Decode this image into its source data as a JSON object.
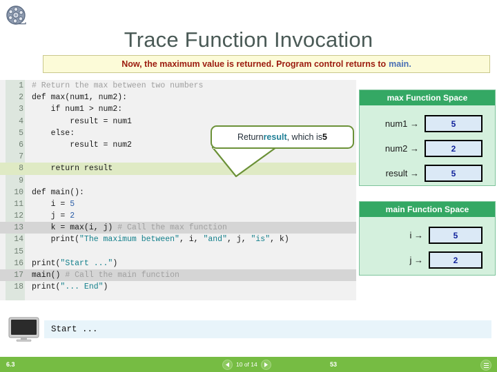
{
  "slide": {
    "title": "Trace Function Invocation",
    "narration": {
      "text": "Now, the maximum value is returned. Program control returns to ",
      "accent": "main.",
      "accent_color": "#4a6fb5",
      "text_color": "#9b1b0e"
    },
    "reel_icon": "film-reel-icon"
  },
  "code": {
    "lines": [
      {
        "n": "1",
        "text": "# Return the max between two numbers",
        "highlight": "none"
      },
      {
        "n": "2",
        "text": "def max(num1, num2):",
        "highlight": "none"
      },
      {
        "n": "3",
        "text": "    if num1 > num2:",
        "highlight": "none"
      },
      {
        "n": "4",
        "text": "        result = num1",
        "highlight": "none"
      },
      {
        "n": "5",
        "text": "    else:",
        "highlight": "none"
      },
      {
        "n": "6",
        "text": "        result = num2",
        "highlight": "none"
      },
      {
        "n": "7",
        "text": "",
        "highlight": "none"
      },
      {
        "n": "8",
        "text": "    return result",
        "highlight": "green"
      },
      {
        "n": "9",
        "text": "",
        "highlight": "none"
      },
      {
        "n": "10",
        "text": "def main():",
        "highlight": "none"
      },
      {
        "n": "11",
        "text": "    i = 5",
        "highlight": "none"
      },
      {
        "n": "12",
        "text": "    j = 2",
        "highlight": "none"
      },
      {
        "n": "13",
        "text": "    k = max(i, j) # Call the max function",
        "highlight": "gray"
      },
      {
        "n": "14",
        "text": "    print(\"The maximum between\", i, \"and\", j, \"is\", k)",
        "highlight": "none"
      },
      {
        "n": "15",
        "text": "",
        "highlight": "none"
      },
      {
        "n": "16",
        "text": "print(\"Start ...\")",
        "highlight": "none"
      },
      {
        "n": "17",
        "text": "main() # Call the main function",
        "highlight": "gray"
      },
      {
        "n": "18",
        "text": "print(\"... End\")",
        "highlight": "none"
      }
    ]
  },
  "callout": {
    "prefix": "Return ",
    "variable": "result",
    "middle": ", which is ",
    "value": "5",
    "border_color": "#6b9137",
    "variable_color": "#1f7f96"
  },
  "max_space": {
    "header": "max Function Space",
    "header_color": "#34a864",
    "body_color": "#d4f0dd",
    "vars": [
      {
        "name": "num1 →",
        "value": "5"
      },
      {
        "name": "num2 →",
        "value": "2"
      },
      {
        "name": "result →",
        "value": "5"
      }
    ]
  },
  "main_space": {
    "header": "main Function Space",
    "header_color": "#34a864",
    "body_color": "#d4f0dd",
    "vars": [
      {
        "name": "i →",
        "value": "5"
      },
      {
        "name": "j →",
        "value": "2"
      }
    ]
  },
  "console": {
    "icon": "monitor-icon",
    "output": "Start ..."
  },
  "footer": {
    "left_label": "6.3",
    "counter": "10 of 14",
    "page_number": "53",
    "bar_color": "#76bc43"
  }
}
